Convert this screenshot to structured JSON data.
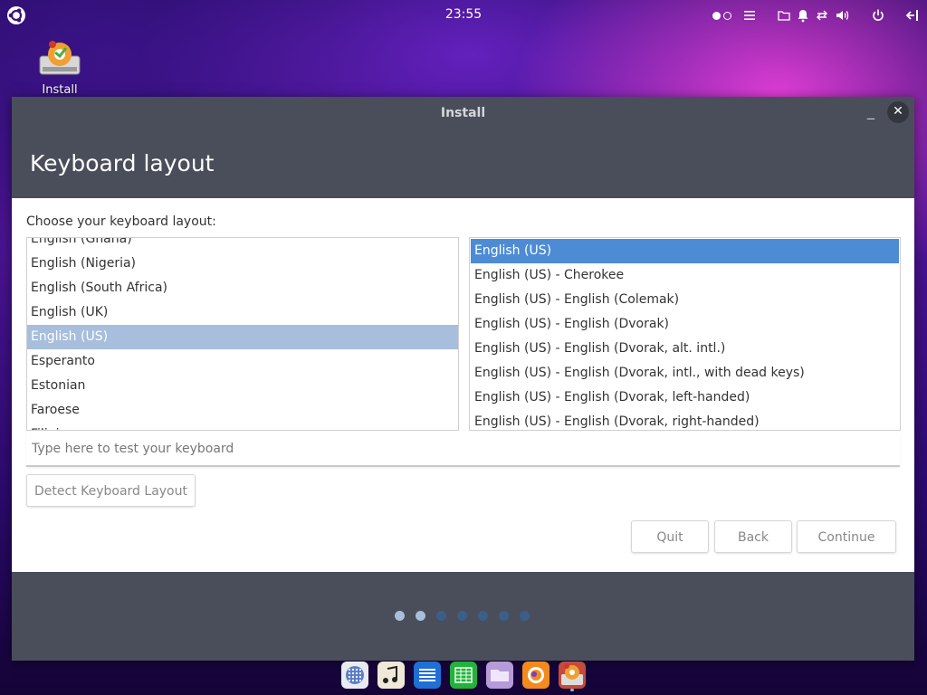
{
  "top_panel": {
    "clock": "23:55",
    "icons": [
      "ubuntu-logo-icon",
      "workspace-indicator-icon",
      "menu-icon",
      "folder-icon",
      "bell-icon",
      "network-icon",
      "volume-icon",
      "power-icon",
      "logout-icon"
    ]
  },
  "desktop": {
    "install_icon_label": "Install"
  },
  "window": {
    "title": "Install",
    "heading": "Keyboard layout",
    "prompt": "Choose your keyboard layout:",
    "layouts": [
      {
        "label": "English (Ghana)"
      },
      {
        "label": "English (Nigeria)"
      },
      {
        "label": "English (South Africa)"
      },
      {
        "label": "English (UK)"
      },
      {
        "label": "English (US)",
        "selected": true
      },
      {
        "label": "Esperanto"
      },
      {
        "label": "Estonian"
      },
      {
        "label": "Faroese"
      },
      {
        "label": "Filipino"
      }
    ],
    "variants": [
      {
        "label": "English (US)",
        "selected": true
      },
      {
        "label": "English (US) - Cherokee"
      },
      {
        "label": "English (US) - English (Colemak)"
      },
      {
        "label": "English (US) - English (Dvorak)"
      },
      {
        "label": "English (US) - English (Dvorak, alt. intl.)"
      },
      {
        "label": "English (US) - English (Dvorak, intl., with dead keys)"
      },
      {
        "label": "English (US) - English (Dvorak, left-handed)"
      },
      {
        "label": "English (US) - English (Dvorak, right-handed)"
      }
    ],
    "test_placeholder": "Type here to test your keyboard",
    "detect_label": "Detect Keyboard Layout",
    "quit_label": "Quit",
    "back_label": "Back",
    "continue_label": "Continue",
    "progress": {
      "total_steps": 7,
      "completed_steps": 2
    }
  },
  "dock": {
    "apps": [
      {
        "name": "app-grid-icon",
        "color": "#e8ecf2"
      },
      {
        "name": "music-icon",
        "color": "#efe9d8"
      },
      {
        "name": "text-editor-icon",
        "color": "#1f6fd6"
      },
      {
        "name": "spreadsheet-icon",
        "color": "#21b33a"
      },
      {
        "name": "files-icon",
        "color": "#b79ad8"
      },
      {
        "name": "firefox-icon",
        "color": "#f28a1e"
      },
      {
        "name": "installer-icon",
        "color": "#c44b3d",
        "running": true
      }
    ]
  }
}
